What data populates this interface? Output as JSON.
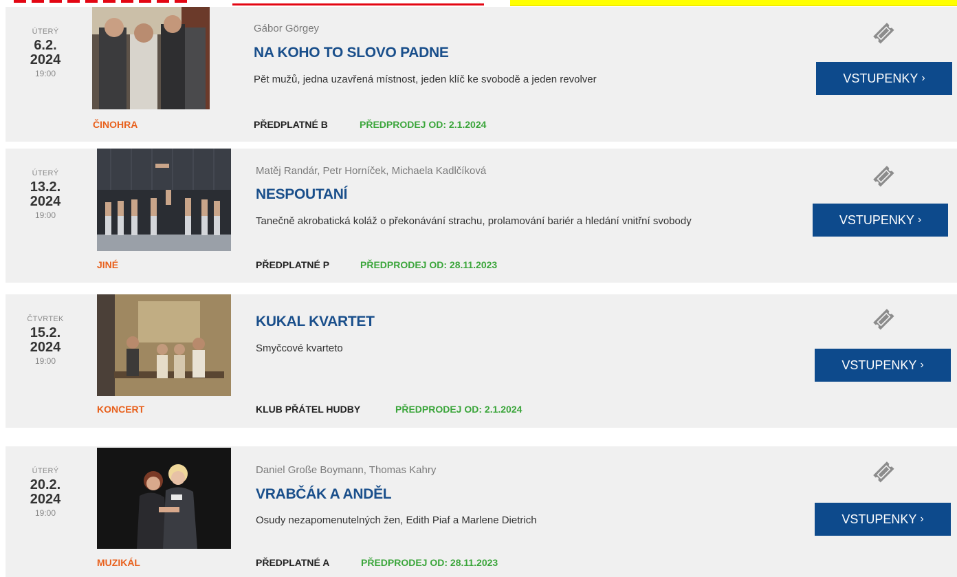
{
  "colors": {
    "title_blue": "#1a4f8b",
    "genre_orange": "#e8601c",
    "presale_green": "#3aa53a",
    "button_blue": "#0d4a8c",
    "row_gray": "#f0f0f0"
  },
  "events": [
    {
      "dow": "ÚTERÝ",
      "day": "6.2.",
      "year": "2024",
      "time": "19:00",
      "genre": "ČINOHRA",
      "authors": "Gábor Görgey",
      "title": "NA KOHO TO SLOVO PADNE",
      "description": "Pět mužů, jedna uzavřená místnost, jeden klíč ke svobodě a jeden revolver",
      "subscription": "PŘEDPLATNÉ B",
      "presale": "PŘEDPRODEJ OD: 2.1.2024",
      "button": "VSTUPENKY",
      "icon": "ticket-icon"
    },
    {
      "dow": "ÚTERÝ",
      "day": "13.2.",
      "year": "2024",
      "time": "19:00",
      "genre": "JINÉ",
      "authors": "Matěj Randár, Petr Horníček, Michaela Kadlčíková",
      "title": "NESPOUTANÍ",
      "description": "Tanečně akrobatická koláž o překonávání strachu, prolamování bariér a hledání vnitřní svobody",
      "subscription": "PŘEDPLATNÉ P",
      "presale": "PŘEDPRODEJ OD: 28.11.2023",
      "button": "VSTUPENKY",
      "icon": "ticket-icon"
    },
    {
      "dow": "ČTVRTEK",
      "day": "15.2.",
      "year": "2024",
      "time": "19:00",
      "genre": "KONCERT",
      "authors": "",
      "title": "KUKAL KVARTET",
      "description": "Smyčcové kvarteto",
      "subscription": "KLUB PŘÁTEL HUDBY",
      "presale": "PŘEDPRODEJ OD: 2.1.2024",
      "button": "VSTUPENKY",
      "icon": "ticket-icon"
    },
    {
      "dow": "ÚTERÝ",
      "day": "20.2.",
      "year": "2024",
      "time": "19:00",
      "genre": "MUZIKÁL",
      "authors": "Daniel Große Boymann, Thomas Kahry",
      "title": "VRABČÁK A ANDĚL",
      "description": "Osudy nezapomenutelných žen, Edith Piaf a Marlene Dietrich",
      "subscription": "PŘEDPLATNÉ A",
      "presale": "PŘEDPRODEJ OD: 28.11.2023",
      "button": "VSTUPENKY",
      "icon": "ticket-icon"
    }
  ]
}
